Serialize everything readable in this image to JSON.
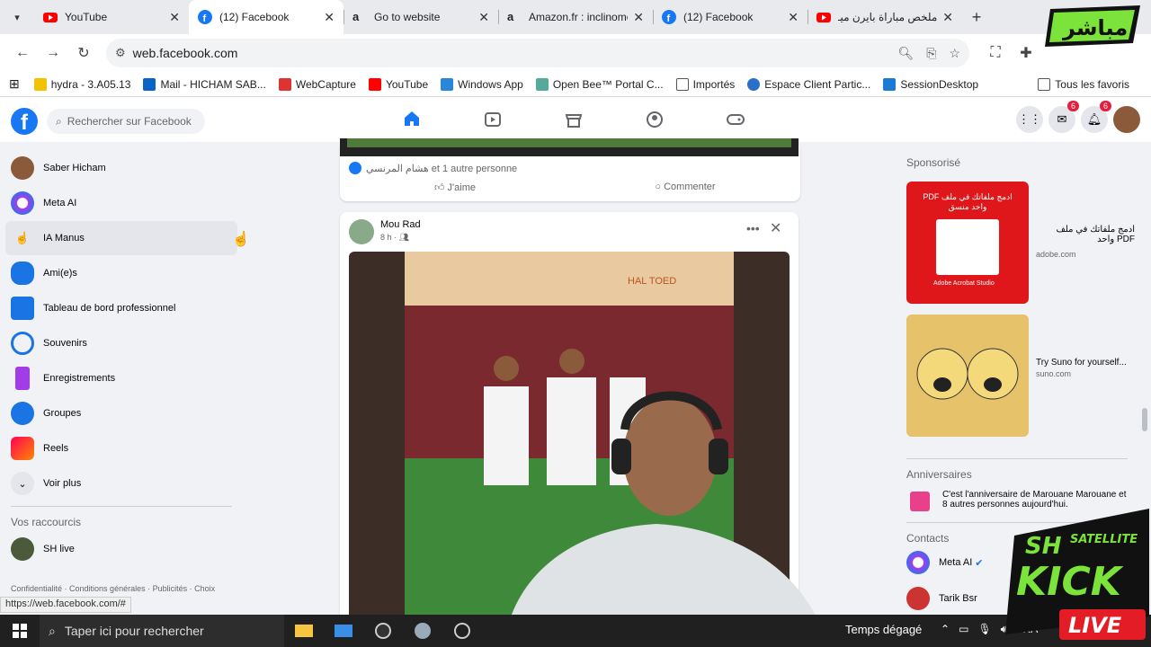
{
  "browser": {
    "tabs": [
      {
        "title": "YouTube",
        "icon": "youtube-icon",
        "active": false
      },
      {
        "title": "(12) Facebook",
        "icon": "facebook-icon",
        "active": true
      },
      {
        "title": "Go to website",
        "icon": "amazon-icon",
        "active": false
      },
      {
        "title": "Amazon.fr : inclinome",
        "icon": "amazon-icon",
        "active": false
      },
      {
        "title": "(12) Facebook",
        "icon": "facebook-icon",
        "active": false
      },
      {
        "title": "ملخص مباراة بايرن ميـ",
        "icon": "youtube-icon",
        "active": false
      }
    ],
    "url": "web.facebook.com",
    "bookmarks": [
      {
        "label": "hydra - 3.A05.13"
      },
      {
        "label": "Mail - HICHAM SAB..."
      },
      {
        "label": "WebCapture"
      },
      {
        "label": "YouTube"
      },
      {
        "label": "Windows App"
      },
      {
        "label": "Open Bee™ Portal C..."
      },
      {
        "label": "Importés"
      },
      {
        "label": "Espace Client Partic..."
      },
      {
        "label": "SessionDesktop"
      }
    ],
    "bookmarks_all": "Tous les favoris"
  },
  "facebook": {
    "search_placeholder": "Rechercher sur Facebook",
    "messenger_badge": "6",
    "notif_badge": "6",
    "sidebar": [
      {
        "label": "Saber Hicham",
        "icon": "profile-avatar"
      },
      {
        "label": "Meta AI",
        "icon": "meta-ai-icon"
      },
      {
        "label": "IA Manus",
        "icon": "manus-icon"
      },
      {
        "label": "Ami(e)s",
        "icon": "friends-icon"
      },
      {
        "label": "Tableau de bord professionnel",
        "icon": "dashboard-icon"
      },
      {
        "label": "Souvenirs",
        "icon": "memories-icon"
      },
      {
        "label": "Enregistrements",
        "icon": "bookmark-icon"
      },
      {
        "label": "Groupes",
        "icon": "groups-icon"
      },
      {
        "label": "Reels",
        "icon": "reels-icon"
      },
      {
        "label": "Voir plus",
        "icon": "chevron-down-icon"
      }
    ],
    "shortcuts_title": "Vos raccourcis",
    "shortcuts": [
      {
        "label": "SH live"
      }
    ],
    "footer": "Confidentialité · Conditions générales · Publicités · Choix",
    "post1": {
      "reactions": "هشام المرنسي et 1 autre personne",
      "like": "J'aime",
      "comment": "Commenter"
    },
    "post2": {
      "author": "Mou Rad",
      "time": "8 h ·",
      "stadium_text": "HAL TOED"
    },
    "sponsored_title": "Sponsorisé",
    "ads": [
      {
        "text": "ادمج ملفاتك في ملف PDF واحد",
        "domain": "adobe.com",
        "img_text": "ادمج ملفاتك في ملف PDF واحد منسق",
        "img_footer": "Adobe Acrobat Studio"
      },
      {
        "text": "Try Suno for yourself...",
        "domain": "suno.com"
      }
    ],
    "birthdays_title": "Anniversaires",
    "birthday_text": "C'est l'anniversaire de Marouane Marouane et 8 autres personnes aujourd'hui.",
    "contacts_title": "Contacts",
    "contacts": [
      {
        "label": "Meta AI"
      },
      {
        "label": "Tarik Bsr"
      }
    ]
  },
  "statusbar_url": "https://web.facebook.com/#",
  "taskbar": {
    "search_placeholder": "Taper ici pour rechercher",
    "weather": "Temps dégagé",
    "lang": "FRA"
  },
  "overlays": {
    "top_logo": "مباشر",
    "bottom_logo_1": "SH",
    "bottom_logo_2": "SATELLITE",
    "bottom_logo_3": "KICK",
    "bottom_logo_4": "LIVE"
  }
}
